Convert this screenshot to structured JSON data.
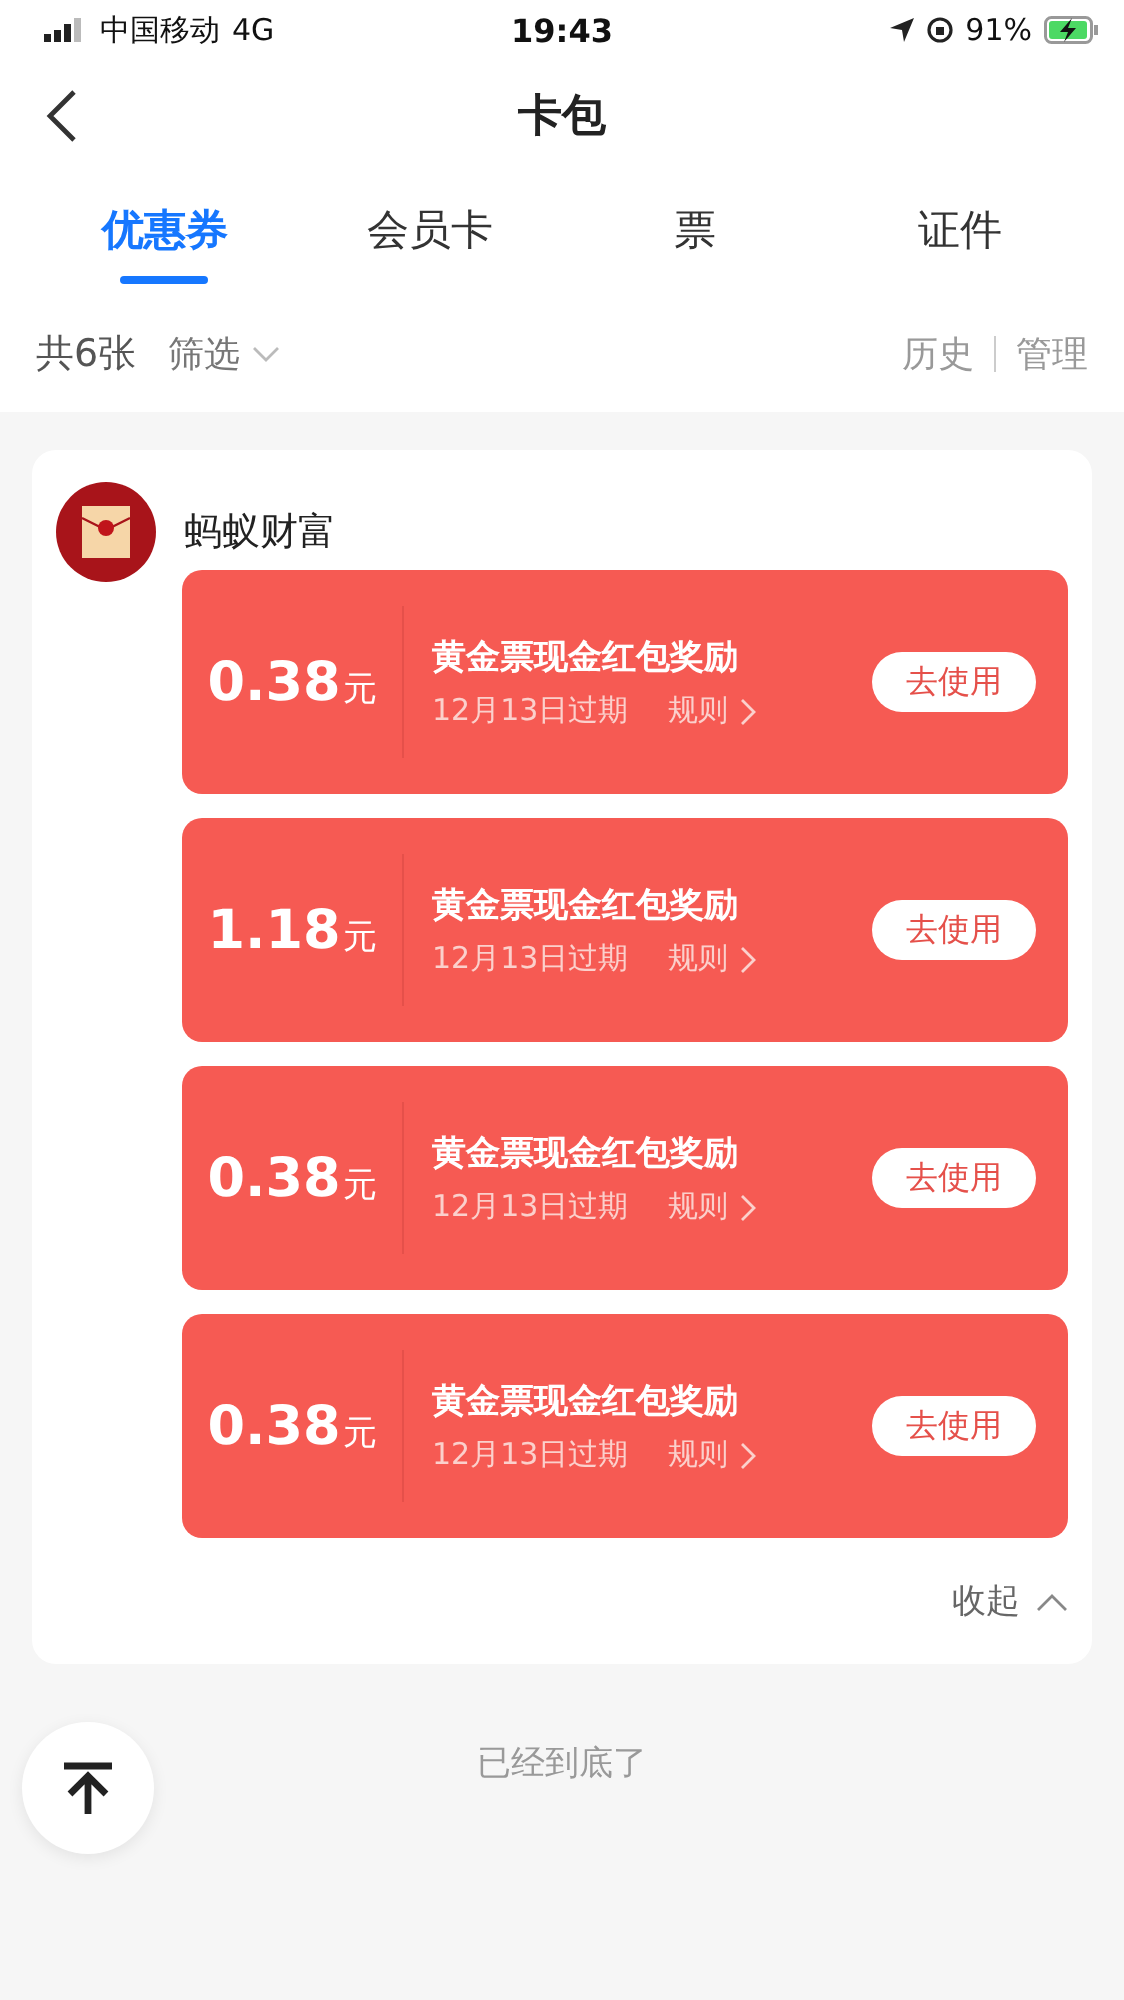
{
  "status_bar": {
    "carrier": "中国移动",
    "network": "4G",
    "time": "19:43",
    "battery": "91%"
  },
  "nav": {
    "title": "卡包"
  },
  "tabs": [
    {
      "label": "优惠券",
      "selected": true
    },
    {
      "label": "会员卡",
      "selected": false
    },
    {
      "label": "票",
      "selected": false
    },
    {
      "label": "证件",
      "selected": false
    }
  ],
  "filter_bar": {
    "count": "共6张",
    "filter": "筛选",
    "history": "历史",
    "manage": "管理"
  },
  "group": {
    "name": "蚂蚁财富",
    "collapse": "收起",
    "coupons": [
      {
        "amount": "0.38",
        "unit": "元",
        "title": "黄金票现金红包奖励",
        "expiry": "12月13日过期",
        "rules": "规则",
        "action": "去使用"
      },
      {
        "amount": "1.18",
        "unit": "元",
        "title": "黄金票现金红包奖励",
        "expiry": "12月13日过期",
        "rules": "规则",
        "action": "去使用"
      },
      {
        "amount": "0.38",
        "unit": "元",
        "title": "黄金票现金红包奖励",
        "expiry": "12月13日过期",
        "rules": "规则",
        "action": "去使用"
      },
      {
        "amount": "0.38",
        "unit": "元",
        "title": "黄金票现金红包奖励",
        "expiry": "12月13日过期",
        "rules": "规则",
        "action": "去使用"
      }
    ]
  },
  "footer": {
    "end_text": "已经到底了"
  }
}
